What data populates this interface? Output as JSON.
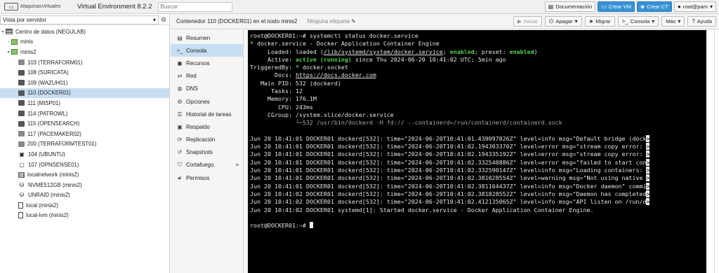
{
  "topbar": {
    "logo_text": "MaquinasVirtuales",
    "app_title": "Virtual Environment 8.2.2",
    "search_placeholder": "Buscar",
    "buttons": {
      "docs": "Documentación",
      "create_vm": "Crear VM",
      "create_ct": "Crear CT",
      "user": "root@pam"
    }
  },
  "left": {
    "view_select": "Vista por servidor",
    "tree": [
      {
        "label": "Centro de datos (NEGULAB)"
      },
      {
        "label": "minis"
      },
      {
        "label": "minis2"
      },
      {
        "label": "103 (TERRAFORM01)"
      },
      {
        "label": "108 (SURICATA)"
      },
      {
        "label": "109 (WAZUH01)"
      },
      {
        "label": "110 (DOCKER01)"
      },
      {
        "label": "111 (MISP01)"
      },
      {
        "label": "114 (PATROWL)"
      },
      {
        "label": "115 (OPENSEARCH)"
      },
      {
        "label": "117 (PACEMAKER02)"
      },
      {
        "label": "200 (TERRAFORMTEST01)"
      },
      {
        "label": "104 (UBUNTU)"
      },
      {
        "label": "107 (OPNSENSE01)"
      },
      {
        "label": "localnetwork (minis2)"
      },
      {
        "label": "NVME512GB (minis2)"
      },
      {
        "label": "UNRAID (minis2)"
      },
      {
        "label": "local (minis2)"
      },
      {
        "label": "local-lvm (minis2)"
      }
    ]
  },
  "content_header": {
    "title": "Contenedor 110 (DOCKER01) en el nodo minis2",
    "tag": "Ninguna etiqueta",
    "actions": {
      "start": "Iniciar",
      "shutdown": "Apagar",
      "migrate": "Migrar",
      "console": "Consola",
      "more": "Más",
      "help": "Ayuda"
    }
  },
  "subnav": [
    {
      "label": "Resumen"
    },
    {
      "label": "Consola"
    },
    {
      "label": "Recursos"
    },
    {
      "label": "Red"
    },
    {
      "label": "DNS"
    },
    {
      "label": "Opciones"
    },
    {
      "label": "Historial de tareas"
    },
    {
      "label": "Respaldo"
    },
    {
      "label": "Replicación"
    },
    {
      "label": "Snapshots"
    },
    {
      "label": "Cortafuego"
    },
    {
      "label": "Permisos"
    }
  ],
  "terminal": {
    "prompt": "root@DOCKER01:~# ",
    "command": "systemctl status docker.service",
    "status": {
      "unit_line": " docker.service - Docker Application Container Engine",
      "loaded_pre": "     Loaded: loaded (",
      "loaded_path": "/lib/systemd/system/docker.service",
      "loaded_mid": "; ",
      "enabled": "enabled",
      "loaded_mid2": "; preset: ",
      "preset": "enabled",
      "loaded_post": ")",
      "active_pre": "     Active: ",
      "active_state": "active (running)",
      "active_post": " since Thu 2024-06-20 10:41:02 UTC; 5min ago",
      "triggered": "TriggeredBy: ",
      "triggered_val": " docker.socket",
      "docs_pre": "       Docs: ",
      "docs_url": "https://docs.docker.com",
      "mainpid": "   Main PID: 532 (dockerd)",
      "tasks": "      Tasks: 12",
      "memory": "     Memory: 176.1M",
      "cpu": "        CPU: 243ms",
      "cgroup": "     CGroup: /system.slice/docker.service",
      "cgroup_child": "             └─532 /usr/bin/dockerd -H fd:// --containerd=/run/containerd/containerd.sock"
    },
    "log": [
      "Jun 20 10:41:01 DOCKER01 dockerd[532]: time=\"2024-06-20T10:41:01.439097826Z\" level=info msg=\"Default bridge (dock",
      "Jun 20 10:41:01 DOCKER01 dockerd[532]: time=\"2024-06-20T10:41:02.194303370Z\" level=error msg=\"stream copy error: ",
      "Jun 20 10:41:01 DOCKER01 dockerd[532]: time=\"2024-06-20T10:41:02.194335192Z\" level=error msg=\"stream copy error: ",
      "Jun 20 10:41:01 DOCKER01 dockerd[532]: time=\"2024-06-20T10:41:02.332540886Z\" level=error msg=\"failed to start con",
      "Jun 20 10:41:01 DOCKER01 dockerd[532]: time=\"2024-06-20T10:41:02.332590147Z\" level=info msg=\"Loading containers: ",
      "Jun 20 10:41:01 DOCKER01 dockerd[532]: time=\"2024-06-20T10:41:02.381028554Z\" level=warning msg=\"Not using native ",
      "Jun 20 10:41:01 DOCKER01 dockerd[532]: time=\"2024-06-20T10:41:02.381164437Z\" level=info msg=\"Docker daemon\" commi",
      "Jun 20 10:41:02 DOCKER01 dockerd[532]: time=\"2024-06-20T10:41:02.381828552Z\" level=info msg=\"Daemon has completed",
      "Jun 20 10:41:02 DOCKER01 dockerd[532]: time=\"2024-06-20T10:41:02.412135065Z\" level=info msg=\"API listen on /run/d",
      "Jun 20 10:41:02 DOCKER01 systemd[1]: Started docker.service - Docker Application Container Engine."
    ],
    "trunc_marker": ">",
    "final_prompt": "root@DOCKER01:~# "
  }
}
